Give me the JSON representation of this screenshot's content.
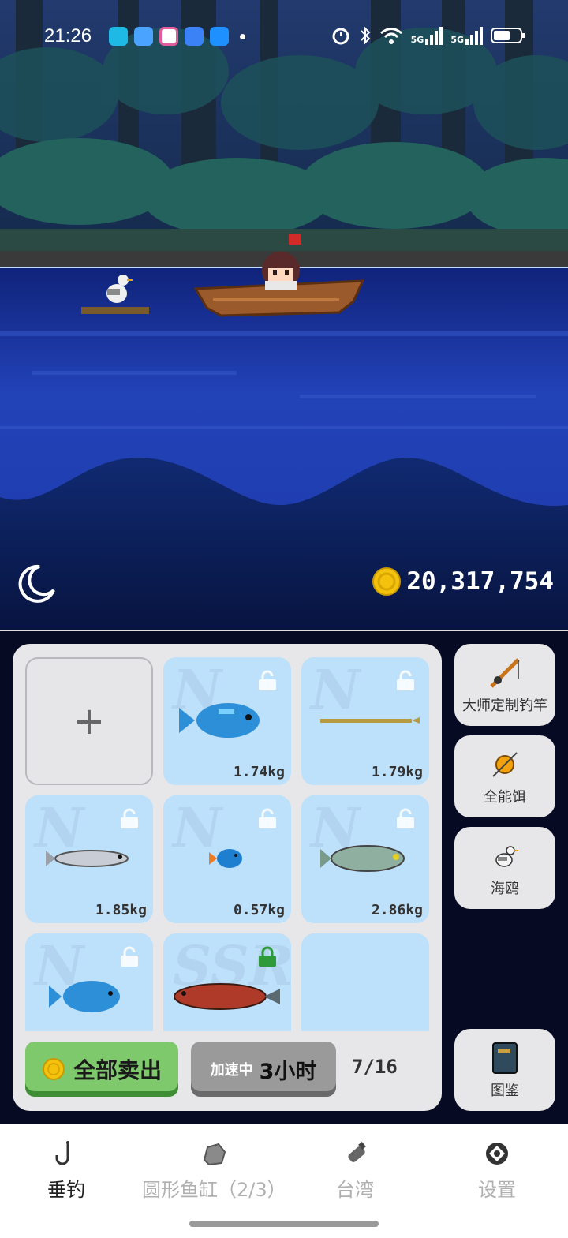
{
  "status_bar": {
    "time": "21:26",
    "network_1": "5G",
    "network_2": "5G"
  },
  "scene": {
    "coins": "20,317,754",
    "night_icon": "moon-icon"
  },
  "inventory": {
    "add_slot_symbol": "+",
    "slots": [
      {
        "rank": "N",
        "weight": "1.74kg",
        "fish": "blue-reef-fish",
        "locked": false
      },
      {
        "rank": "N",
        "weight": "1.79kg",
        "fish": "needlefish",
        "locked": false
      },
      {
        "rank": "N",
        "weight": "1.85kg",
        "fish": "silver-fish",
        "locked": false
      },
      {
        "rank": "N",
        "weight": "0.57kg",
        "fish": "small-blue-fish",
        "locked": false
      },
      {
        "rank": "N",
        "weight": "2.86kg",
        "fish": "mackerel",
        "locked": false
      },
      {
        "rank": "N",
        "weight": "",
        "fish": "blue-reef-fish",
        "locked": false
      },
      {
        "rank": "SSR",
        "weight": "",
        "fish": "red-arowana",
        "locked": true
      }
    ],
    "sell_all_label": "全部卖出",
    "speed_prefix": "加速中",
    "speed_value": "3小时",
    "count": "7/16"
  },
  "side_buttons": {
    "rod_label": "大师定制钓竿",
    "bait_label": "全能饵",
    "seagull_label": "海鸥",
    "book_label": "图鉴"
  },
  "nav": {
    "items": [
      {
        "label": "垂钓",
        "icon": "fishing-hook-icon",
        "active": true
      },
      {
        "label": "圆形鱼缸（2/3）",
        "icon": "rock-icon",
        "active": false
      },
      {
        "label": "台湾",
        "icon": "bottle-icon",
        "active": false
      },
      {
        "label": "设置",
        "icon": "settings-icon",
        "active": false
      }
    ]
  },
  "colors": {
    "slot_bg": "#bde0fb",
    "sell_green": "#7ec96b",
    "speed_gray": "#9a9a9a",
    "water": "#1f3ca8"
  }
}
